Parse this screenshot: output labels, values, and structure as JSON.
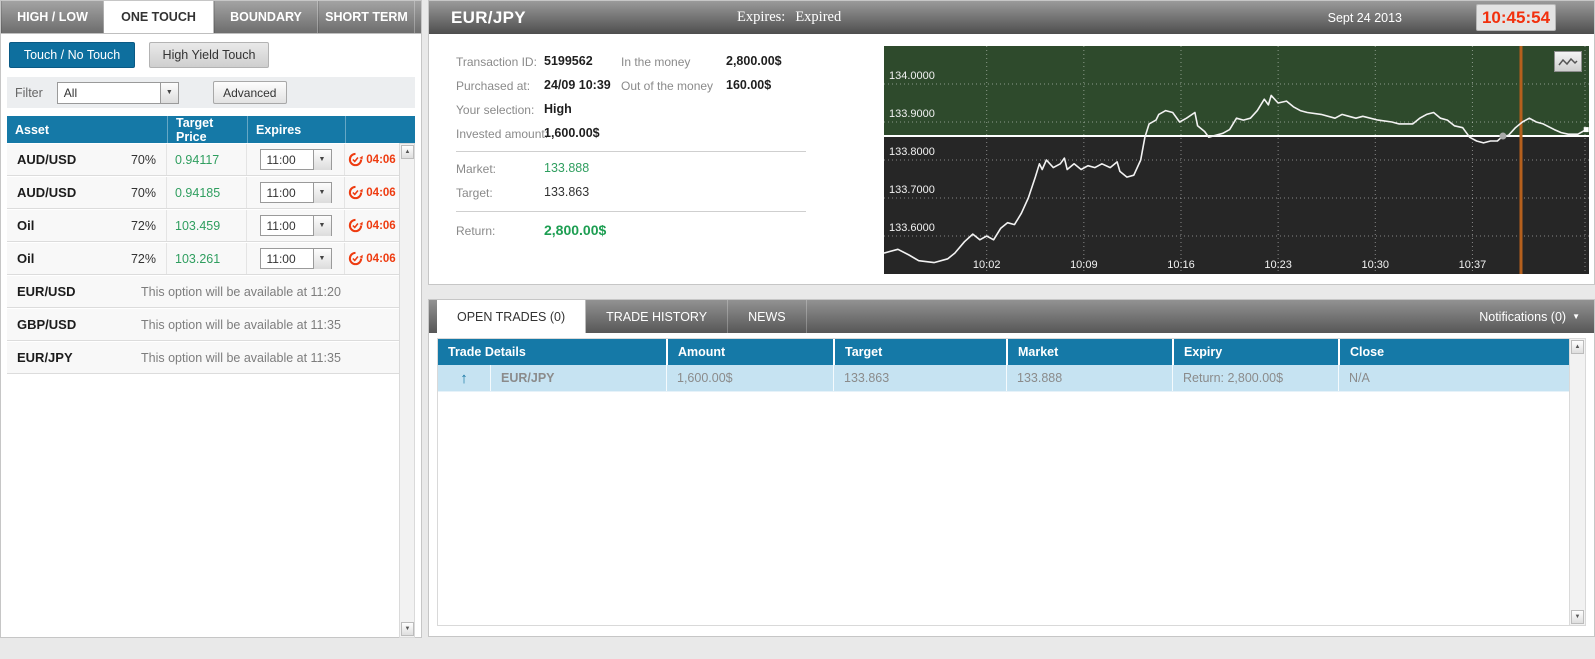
{
  "colors": {
    "accent_blue": "#1579a7",
    "button_blue": "#0e6f9e",
    "green_text": "#2f9e5f",
    "red_alert": "#ee3b10",
    "trade_row_highlight": "#c6e3f2"
  },
  "left_panel": {
    "tabs": [
      {
        "label": "HIGH / LOW",
        "active": false
      },
      {
        "label": "ONE TOUCH",
        "active": true
      },
      {
        "label": "BOUNDARY",
        "active": false
      },
      {
        "label": "SHORT TERM",
        "active": false
      }
    ],
    "mode_buttons": [
      {
        "label": "Touch / No Touch",
        "active": true
      },
      {
        "label": "High Yield Touch",
        "active": false
      }
    ],
    "filter": {
      "label": "Filter",
      "value": "All",
      "advanced_label": "Advanced"
    },
    "table": {
      "headers": {
        "asset": "Asset",
        "target_price": "Target Price",
        "expires": "Expires",
        "blank": ""
      },
      "active_rows": [
        {
          "asset": "AUD/USD",
          "payout": "70%",
          "target_price": "0.94117",
          "expiry": "11:00",
          "countdown": "04:06"
        },
        {
          "asset": "AUD/USD",
          "payout": "70%",
          "target_price": "0.94185",
          "expiry": "11:00",
          "countdown": "04:06"
        },
        {
          "asset": "Oil",
          "payout": "72%",
          "target_price": "103.459",
          "expiry": "11:00",
          "countdown": "04:06"
        },
        {
          "asset": "Oil",
          "payout": "72%",
          "target_price": "103.261",
          "expiry": "11:00",
          "countdown": "04:06"
        }
      ],
      "unavailable_rows": [
        {
          "asset": "EUR/USD",
          "message": "This option will be available at 11:20"
        },
        {
          "asset": "GBP/USD",
          "message": "This option will be available at 11:35"
        },
        {
          "asset": "EUR/JPY",
          "message": "This option will be available at 11:35"
        }
      ]
    }
  },
  "trade_panel": {
    "title": "EUR/JPY",
    "expires_label": "Expires:",
    "expires_value": "Expired",
    "date": "Sept 24 2013",
    "clock": "10:45:54",
    "details": {
      "transaction_id_label": "Transaction ID:",
      "transaction_id": "5199562",
      "purchased_at_label": "Purchased at:",
      "purchased_at": "24/09 10:39",
      "your_selection_label": "Your selection:",
      "your_selection": "High",
      "invested_amount_label": "Invested amount:",
      "invested_amount": "1,600.00$",
      "in_the_money_label": "In the money",
      "in_the_money": "2,800.00$",
      "out_of_the_money_label": "Out of the money",
      "out_of_the_money": "160.00$",
      "market_label": "Market:",
      "market": "133.888",
      "target_label": "Target:",
      "target": "133.863",
      "return_label": "Return:",
      "return": "2,800.00$"
    }
  },
  "chart_data": {
    "type": "line",
    "title": "EUR/JPY intraday price",
    "x_unit": "minutes after 10:00",
    "x_range": [
      -5.4,
      45.4
    ],
    "y_range": [
      133.5,
      134.1
    ],
    "x_ticks": [
      {
        "t": 2,
        "label": "10:02"
      },
      {
        "t": 9,
        "label": "10:09"
      },
      {
        "t": 16,
        "label": "10:16"
      },
      {
        "t": 23,
        "label": "10:23"
      },
      {
        "t": 30,
        "label": "10:30"
      },
      {
        "t": 37,
        "label": "10:37"
      }
    ],
    "y_ticks": [
      {
        "v": 134.0,
        "label": "134.0000"
      },
      {
        "v": 133.9,
        "label": "133.9000"
      },
      {
        "v": 133.8,
        "label": "133.8000"
      },
      {
        "v": 133.7,
        "label": "133.7000"
      },
      {
        "v": 133.6,
        "label": "133.6000"
      }
    ],
    "target_price": 133.863,
    "expiry_line_t": 40.5,
    "purchase_marker": {
      "t": 39.2,
      "price": 133.863
    },
    "grid": true,
    "colors": {
      "above_target_bg": "#2e4a2c",
      "below_target_bg": "#262626",
      "line": "#f2f2f2",
      "grid": "#ffffff",
      "target_line": "#ffffff",
      "expiry_line": "#b5601d",
      "marker": "#a9a9a9"
    },
    "points": [
      [
        -5.4,
        133.555
      ],
      [
        -4.4,
        133.565
      ],
      [
        -3.6,
        133.55
      ],
      [
        -2.9,
        133.535
      ],
      [
        -1.8,
        133.53
      ],
      [
        -0.8,
        133.54
      ],
      [
        -0.3,
        133.555
      ],
      [
        0.4,
        133.585
      ],
      [
        1.0,
        133.605
      ],
      [
        1.5,
        133.59
      ],
      [
        2.0,
        133.6
      ],
      [
        2.5,
        133.59
      ],
      [
        3.0,
        133.62
      ],
      [
        3.5,
        133.635
      ],
      [
        4.0,
        133.63
      ],
      [
        4.5,
        133.66
      ],
      [
        5.0,
        133.7
      ],
      [
        5.5,
        133.755
      ],
      [
        5.8,
        133.79
      ],
      [
        6.0,
        133.775
      ],
      [
        6.3,
        133.8
      ],
      [
        6.8,
        133.78
      ],
      [
        7.3,
        133.79
      ],
      [
        7.6,
        133.805
      ],
      [
        7.8,
        133.775
      ],
      [
        8.3,
        133.79
      ],
      [
        8.8,
        133.775
      ],
      [
        9.3,
        133.785
      ],
      [
        9.8,
        133.78
      ],
      [
        10.3,
        133.79
      ],
      [
        10.9,
        133.78
      ],
      [
        11.4,
        133.795
      ],
      [
        11.6,
        133.77
      ],
      [
        12.1,
        133.755
      ],
      [
        12.6,
        133.76
      ],
      [
        13.1,
        133.8
      ],
      [
        13.4,
        133.86
      ],
      [
        13.7,
        133.895
      ],
      [
        14.2,
        133.905
      ],
      [
        14.4,
        133.92
      ],
      [
        14.9,
        133.93
      ],
      [
        15.4,
        133.925
      ],
      [
        15.9,
        133.9
      ],
      [
        16.4,
        133.91
      ],
      [
        17.0,
        133.925
      ],
      [
        17.2,
        133.89
      ],
      [
        17.7,
        133.875
      ],
      [
        18.0,
        133.86
      ],
      [
        18.5,
        133.865
      ],
      [
        19.0,
        133.87
      ],
      [
        19.5,
        133.88
      ],
      [
        20.0,
        133.91
      ],
      [
        20.5,
        133.905
      ],
      [
        21.0,
        133.91
      ],
      [
        21.5,
        133.93
      ],
      [
        22.0,
        133.96
      ],
      [
        22.3,
        133.945
      ],
      [
        22.5,
        133.97
      ],
      [
        23.0,
        133.95
      ],
      [
        23.6,
        133.955
      ],
      [
        24.1,
        133.94
      ],
      [
        24.6,
        133.93
      ],
      [
        25.1,
        133.925
      ],
      [
        26.1,
        133.92
      ],
      [
        27.1,
        133.91
      ],
      [
        27.6,
        133.92
      ],
      [
        28.1,
        133.915
      ],
      [
        28.6,
        133.91
      ],
      [
        29.1,
        133.915
      ],
      [
        30.2,
        133.905
      ],
      [
        31.2,
        133.9
      ],
      [
        31.7,
        133.895
      ],
      [
        32.7,
        133.895
      ],
      [
        33.2,
        133.91
      ],
      [
        33.7,
        133.92
      ],
      [
        34.2,
        133.925
      ],
      [
        34.7,
        133.91
      ],
      [
        35.2,
        133.905
      ],
      [
        35.7,
        133.89
      ],
      [
        36.3,
        133.885
      ],
      [
        36.8,
        133.86
      ],
      [
        37.3,
        133.85
      ],
      [
        37.8,
        133.845
      ],
      [
        38.3,
        133.85
      ],
      [
        38.8,
        133.85
      ],
      [
        39.1,
        133.86
      ],
      [
        39.6,
        133.865
      ],
      [
        40.1,
        133.885
      ],
      [
        40.6,
        133.9
      ],
      [
        41.1,
        133.91
      ],
      [
        41.6,
        133.9
      ],
      [
        42.1,
        133.895
      ],
      [
        42.9,
        133.88
      ],
      [
        43.4,
        133.872
      ],
      [
        43.9,
        133.868
      ],
      [
        44.6,
        133.868
      ],
      [
        45.2,
        133.88
      ]
    ]
  },
  "bottom_panel": {
    "tabs": [
      {
        "label": "OPEN TRADES (0)",
        "active": true
      },
      {
        "label": "TRADE HISTORY",
        "active": false
      },
      {
        "label": "NEWS",
        "active": false
      }
    ],
    "notifications_label": "Notifications (0)",
    "table": {
      "headers": {
        "trade_details": "Trade Details",
        "amount": "Amount",
        "target": "Target",
        "market": "Market",
        "expiry": "Expiry",
        "close": "Close"
      },
      "rows": [
        {
          "asset": "EUR/JPY",
          "direction": "up",
          "amount": "1,600.00$",
          "target": "133.863",
          "market": "133.888",
          "expiry": "Return: 2,800.00$",
          "close": "N/A"
        }
      ]
    }
  }
}
